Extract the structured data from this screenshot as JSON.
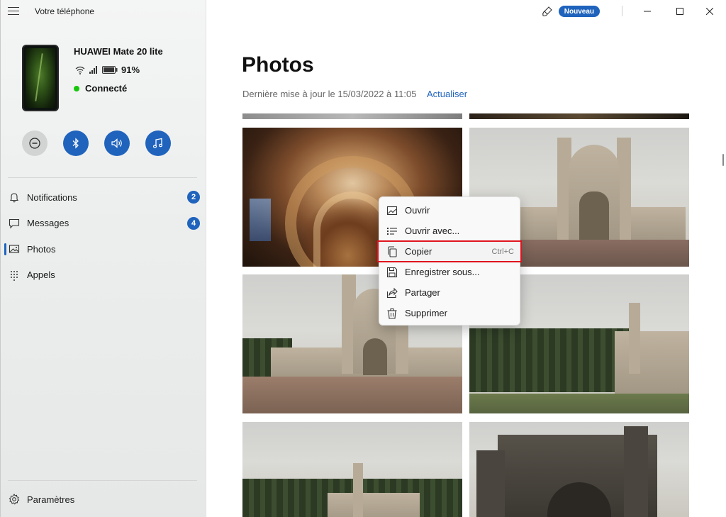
{
  "app": {
    "title": "Votre téléphone"
  },
  "device": {
    "name": "HUAWEI Mate 20 lite",
    "battery": "91%",
    "status": "Connecté"
  },
  "quick_actions": [
    {
      "icon": "do-not-disturb-icon"
    },
    {
      "icon": "bluetooth-icon"
    },
    {
      "icon": "volume-icon"
    },
    {
      "icon": "music-icon"
    }
  ],
  "nav": {
    "items": [
      {
        "label": "Notifications",
        "badge": "2"
      },
      {
        "label": "Messages",
        "badge": "4"
      },
      {
        "label": "Photos",
        "badge": ""
      },
      {
        "label": "Appels",
        "badge": ""
      }
    ],
    "settings": "Paramètres"
  },
  "header": {
    "new_badge": "Nouveau"
  },
  "main": {
    "title": "Photos",
    "last_update": "Dernière mise à jour le 15/03/2022 à 11:05",
    "refresh": "Actualiser"
  },
  "context_menu": {
    "items": [
      {
        "label": "Ouvrir",
        "shortcut": ""
      },
      {
        "label": "Ouvrir avec...",
        "shortcut": ""
      },
      {
        "label": "Copier",
        "shortcut": "Ctrl+C"
      },
      {
        "label": "Enregistrer sous...",
        "shortcut": ""
      },
      {
        "label": "Partager",
        "shortcut": ""
      },
      {
        "label": "Supprimer",
        "shortcut": ""
      }
    ]
  },
  "colors": {
    "accent": "#1f63bd",
    "connected": "#16c60c",
    "highlight_border": "#e0141e"
  }
}
